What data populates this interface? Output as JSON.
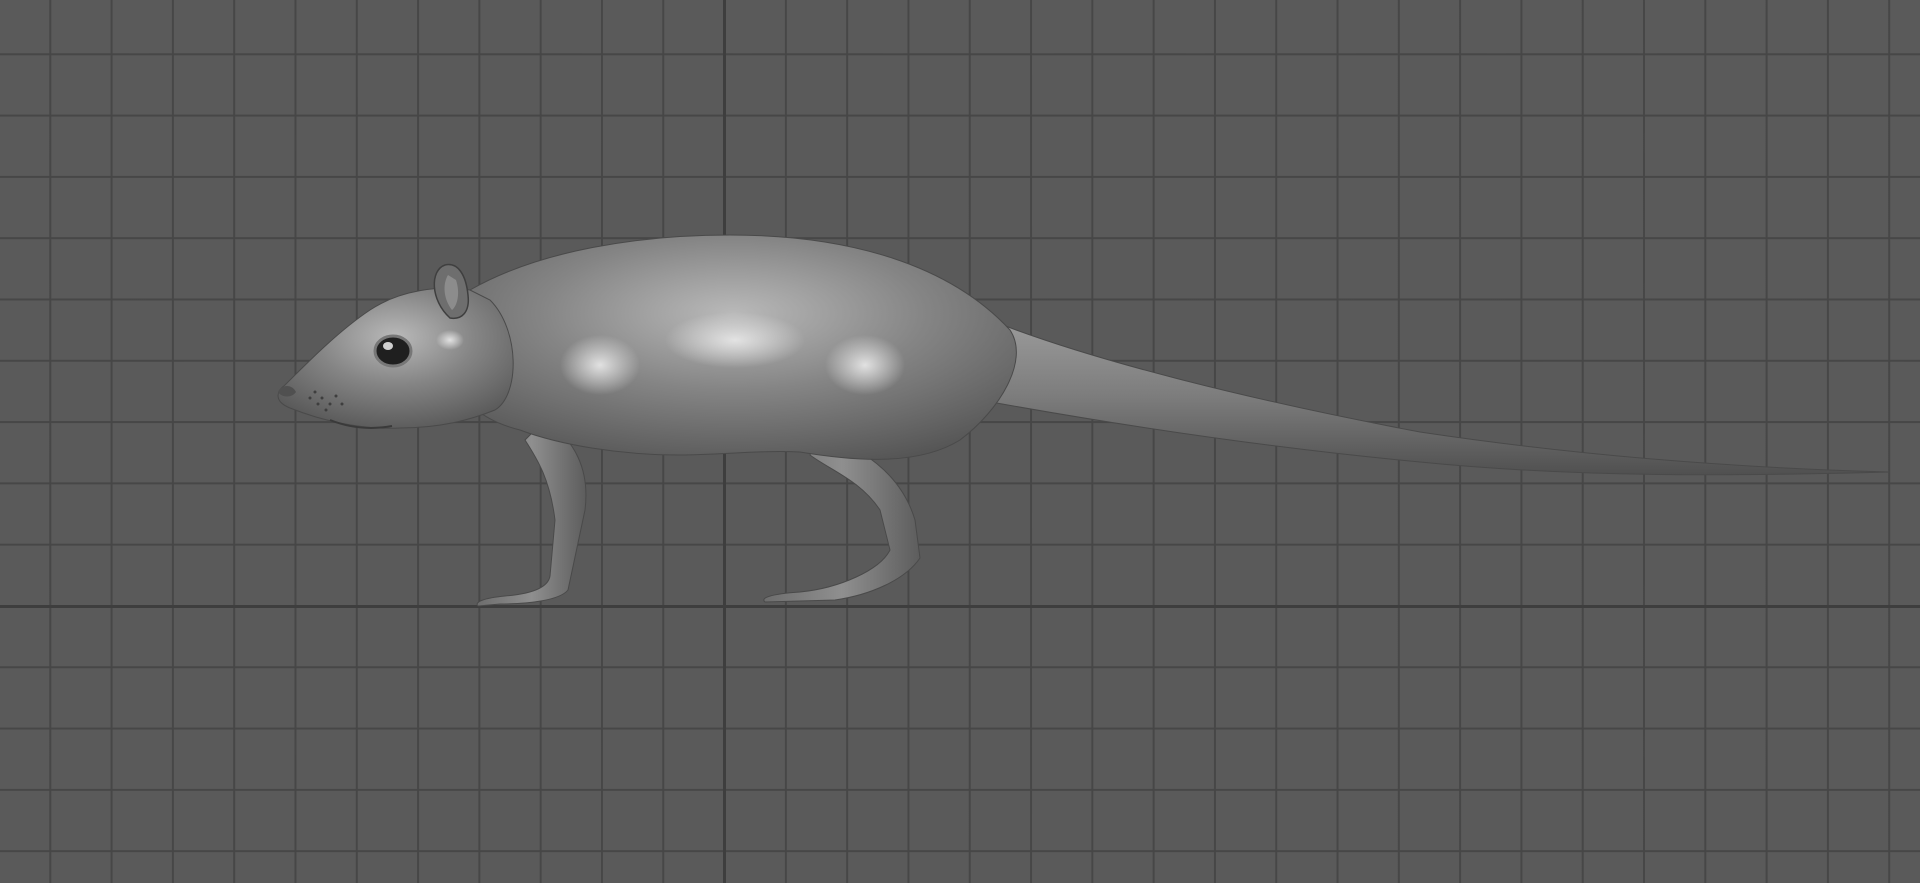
{
  "viewport": {
    "grid": true,
    "background_color": "#5a5a5a",
    "grid_line_color": "#464646",
    "axis_line_color": "#3e3e3e"
  },
  "model": {
    "icon": "rat-model-icon",
    "shading": "smooth-gray",
    "base_color": "#7a7a7a",
    "highlight_color": "#cfcfcf"
  }
}
